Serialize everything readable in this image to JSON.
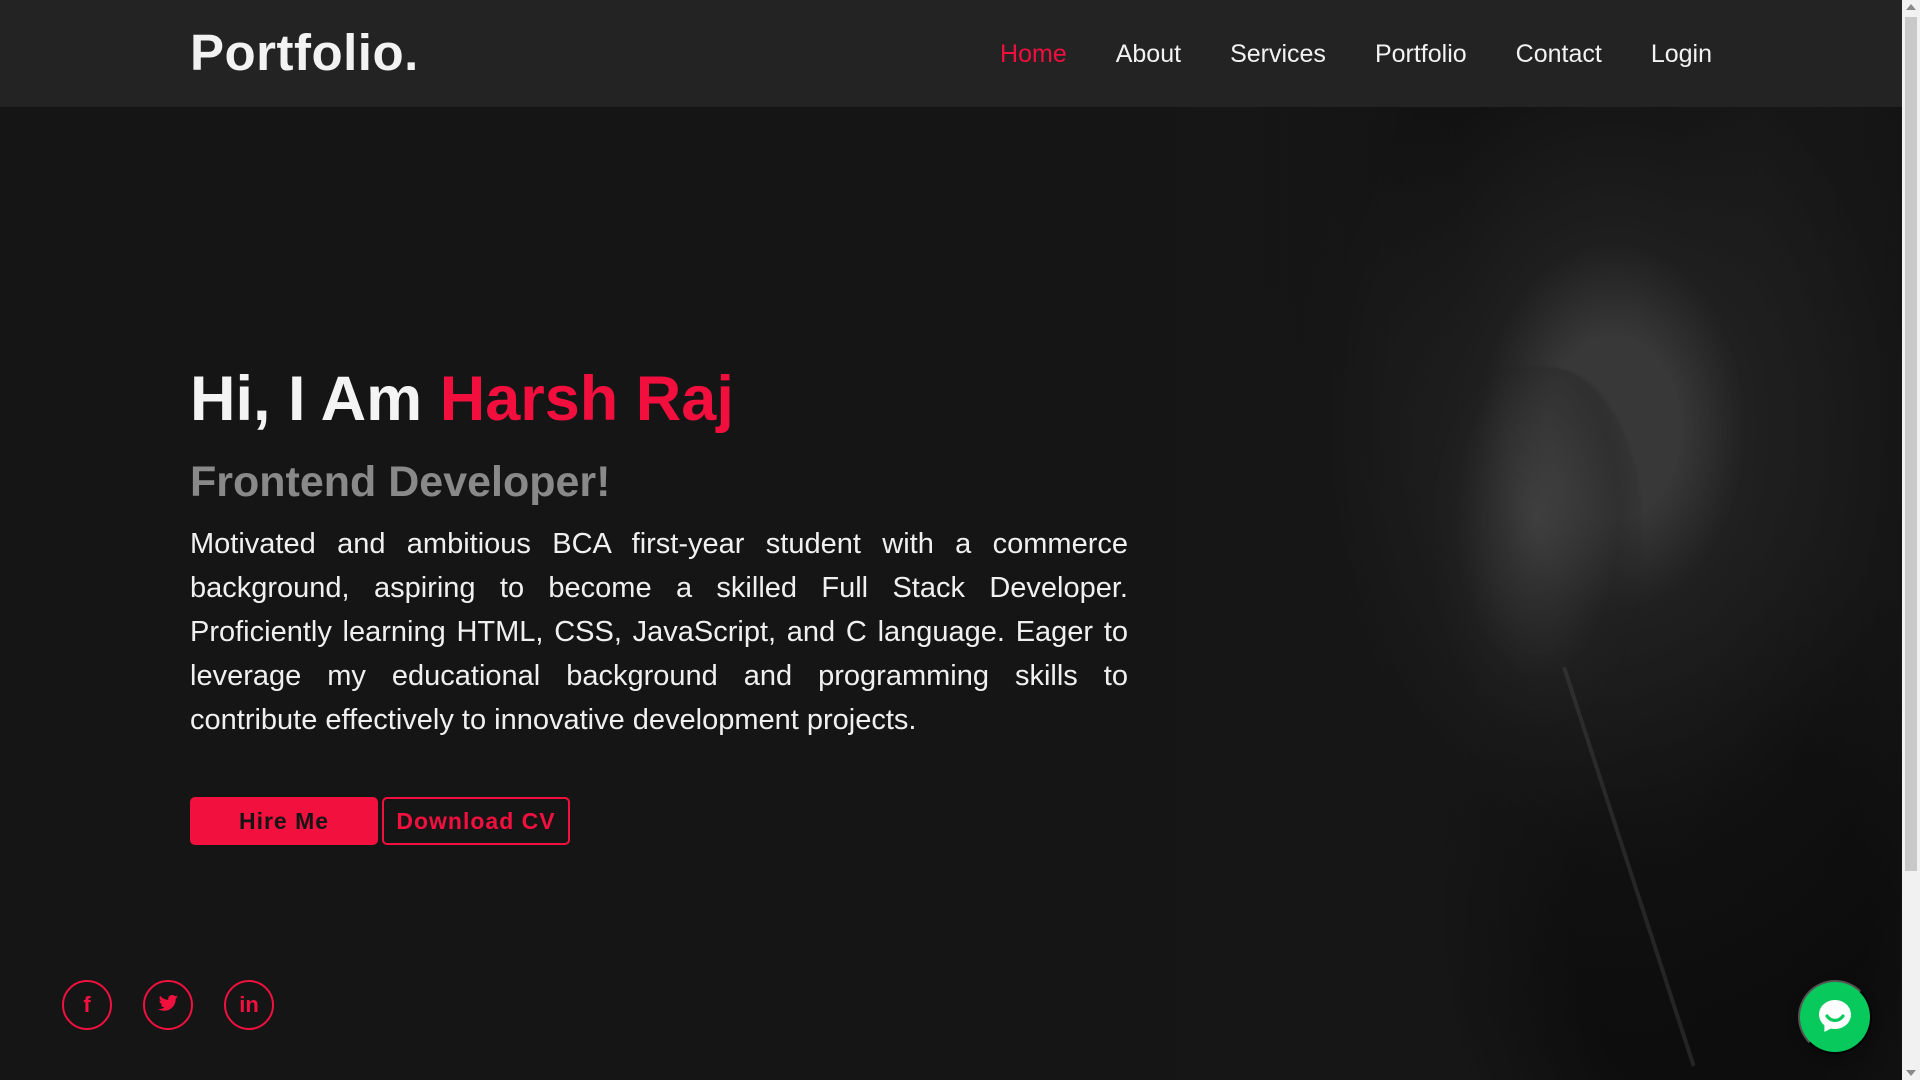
{
  "brand": {
    "logo": "Portfolio."
  },
  "navigation": {
    "items": [
      {
        "label": "Home",
        "active": true
      },
      {
        "label": "About",
        "active": false
      },
      {
        "label": "Services",
        "active": false
      },
      {
        "label": "Portfolio",
        "active": false
      },
      {
        "label": "Contact",
        "active": false
      },
      {
        "label": "Login",
        "active": false
      }
    ]
  },
  "hero": {
    "greeting": "Hi, I Am",
    "name": "Harsh Raj",
    "role": "Frontend Developer!",
    "bio": "Motivated and ambitious BCA first-year student with a commerce background, aspiring to become a skilled Full Stack Developer. Proficiently learning HTML, CSS, JavaScript, and C language. Eager to leverage my educational background and programming skills to contribute effectively to innovative development projects.",
    "primary_button": "Hire Me",
    "secondary_button": "Download CV"
  },
  "social": {
    "facebook": "f",
    "twitter": "",
    "linkedin": "in"
  },
  "icons": {
    "chat": "chat-icon",
    "facebook": "facebook-icon",
    "twitter": "twitter-icon",
    "linkedin": "linkedin-icon"
  },
  "colors": {
    "accent": "#f20f3e",
    "navbar": "#232323",
    "background": "#151515",
    "chat": "#08c95b",
    "muted_role": "#898989"
  }
}
